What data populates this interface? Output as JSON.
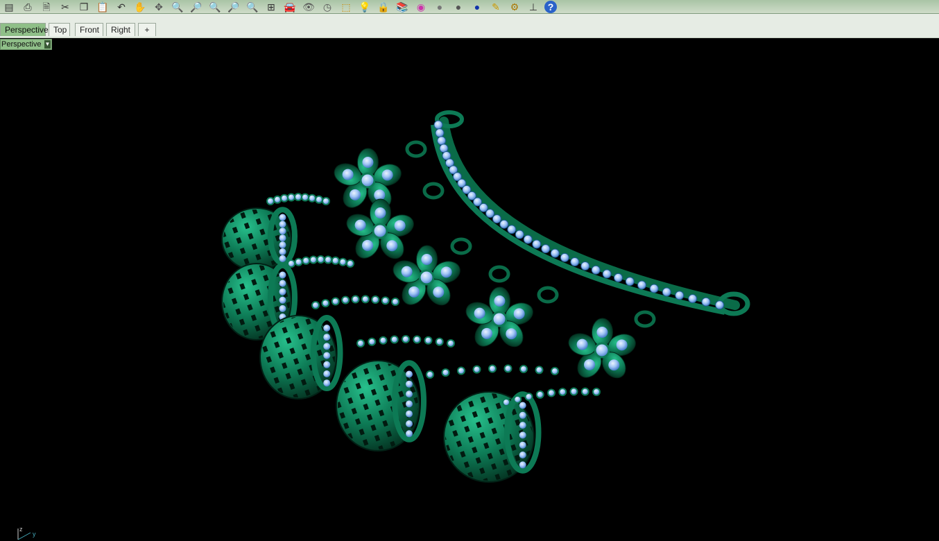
{
  "toolbar": {
    "buttons": [
      {
        "name": "new-icon",
        "glyph": "▤"
      },
      {
        "name": "print-icon",
        "glyph": "⎙"
      },
      {
        "name": "save-icon",
        "glyph": "🗎"
      },
      {
        "name": "cut-icon",
        "glyph": "✂"
      },
      {
        "name": "copy-icon",
        "glyph": "❐"
      },
      {
        "name": "paste-icon",
        "glyph": "📋"
      },
      {
        "name": "undo-icon",
        "glyph": "↶"
      },
      {
        "name": "pan-icon",
        "glyph": "✋"
      },
      {
        "name": "rotate-view-icon",
        "glyph": "✥"
      },
      {
        "name": "zoom-icon",
        "glyph": "🔍"
      },
      {
        "name": "zoom-window-icon",
        "glyph": "🔎"
      },
      {
        "name": "zoom-extents-icon",
        "glyph": "🔍"
      },
      {
        "name": "zoom-selected-icon",
        "glyph": "🔎"
      },
      {
        "name": "zoom-previous-icon",
        "glyph": "🔍"
      },
      {
        "name": "four-viewports-icon",
        "glyph": "⊞"
      },
      {
        "name": "car-icon",
        "glyph": "🚘"
      },
      {
        "name": "hide-icon",
        "glyph": "👁"
      },
      {
        "name": "circle-icon",
        "glyph": "◷"
      },
      {
        "name": "select-objects-icon",
        "glyph": "⬚"
      },
      {
        "name": "light-icon",
        "glyph": "💡"
      },
      {
        "name": "lock-icon",
        "glyph": "🔒"
      },
      {
        "name": "layers-icon",
        "glyph": "📚"
      },
      {
        "name": "color-wheel-icon",
        "glyph": "◉"
      },
      {
        "name": "shaded-sphere-icon",
        "glyph": "●"
      },
      {
        "name": "rendered-sphere-icon",
        "glyph": "●"
      },
      {
        "name": "render-icon",
        "glyph": "●"
      },
      {
        "name": "options-icon",
        "glyph": "✎"
      },
      {
        "name": "settings-gear-icon",
        "glyph": "⚙"
      },
      {
        "name": "dimension-icon",
        "glyph": "⊥"
      },
      {
        "name": "help-icon",
        "glyph": "?"
      }
    ]
  },
  "tabs": {
    "perspective": "Perspective",
    "top": "Top",
    "front": "Front",
    "right": "Right",
    "add": "+"
  },
  "viewport": {
    "label": "Perspective",
    "axis_z": "z",
    "axis_y": "y"
  },
  "colors": {
    "metal": "#0d7a55",
    "metal_dark": "#04301f",
    "stone": "#9fc4f5",
    "stone_dark": "#3a6fc2"
  }
}
